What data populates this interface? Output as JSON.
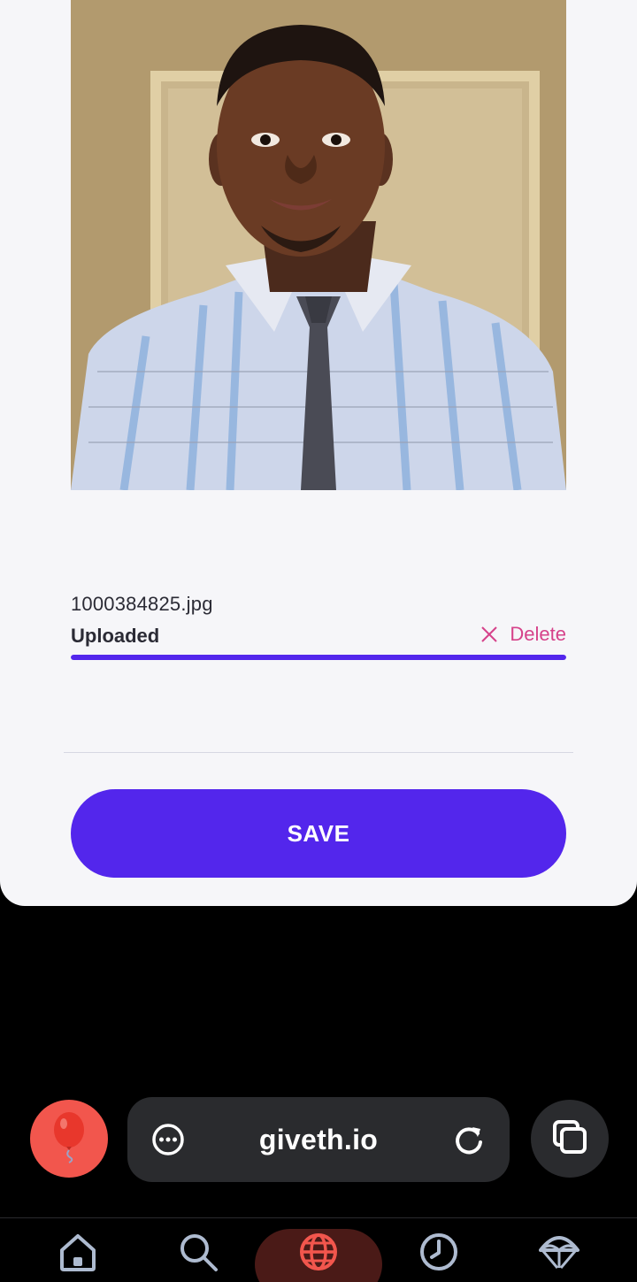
{
  "upload": {
    "file_name": "1000384825.jpg",
    "status": "Uploaded",
    "delete_label": "Delete",
    "progress_percent": 100
  },
  "actions": {
    "save_label": "SAVE"
  },
  "browser": {
    "url": "giveth.io"
  },
  "colors": {
    "primary": "#5326ec",
    "delete": "#d6428a",
    "balloon_bg": "#f2564d",
    "nav_active": "#f2564d"
  },
  "icons": {
    "balloon": "balloon-icon",
    "menu": "more-horizontal-icon",
    "reload": "reload-icon",
    "tabs": "tabs-icon",
    "nav": [
      "home-icon",
      "search-icon",
      "globe-icon",
      "history-icon",
      "parachute-icon"
    ]
  }
}
